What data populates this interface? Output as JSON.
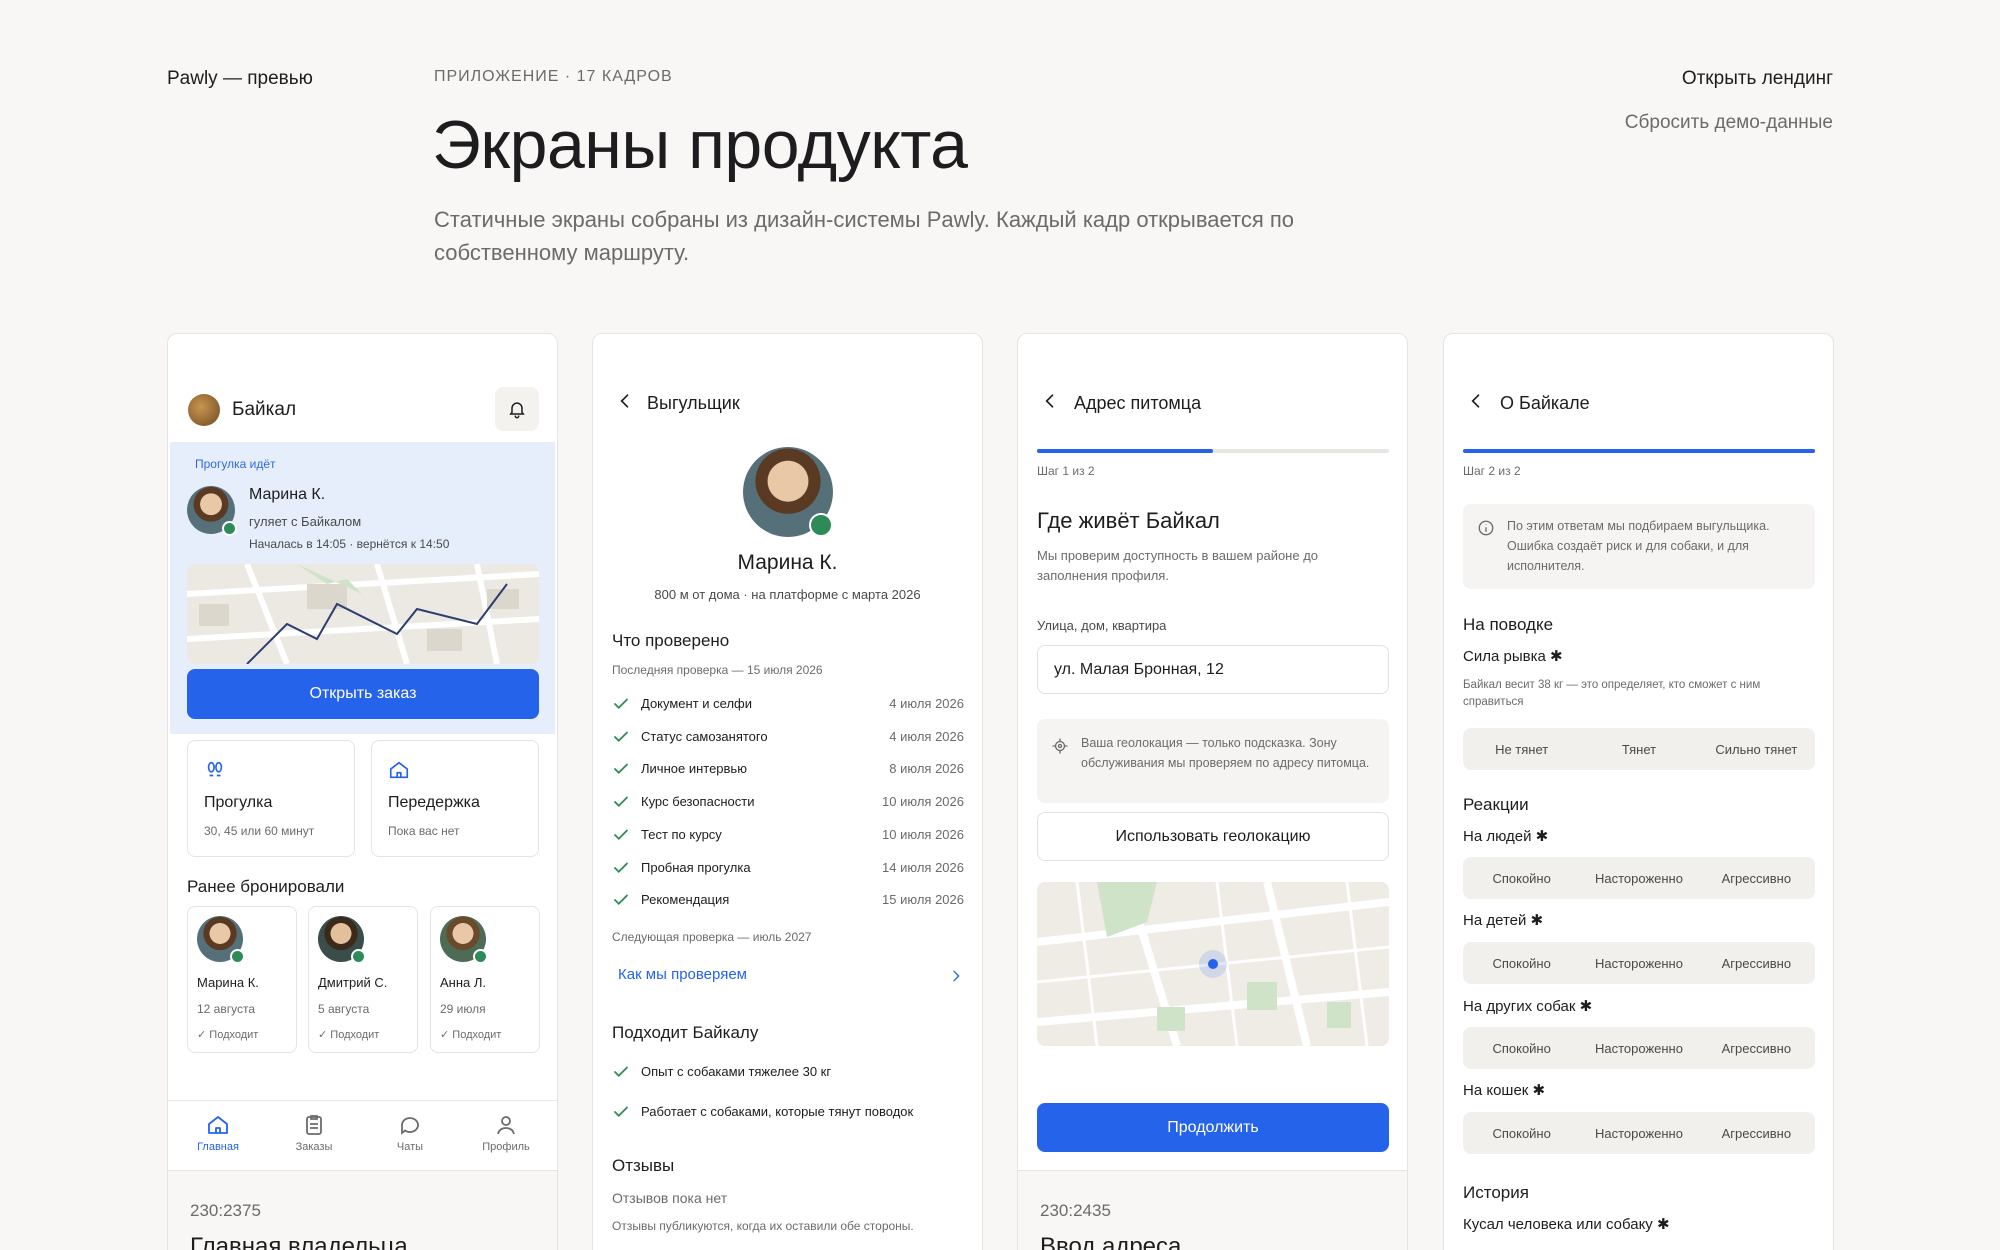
{
  "header": {
    "brand": "Pawly — превью",
    "eyebrow": "ПРИЛОЖЕНИЕ · 17 КАДРОВ",
    "title": "Экраны продукта",
    "description": "Статичные экраны собраны из дизайн-системы Pawly. Каждый кадр открывается по собственному маршруту.",
    "open_landing": "Открыть лендинг",
    "reset_demo": "Сбросить демо-данные"
  },
  "frame1": {
    "pet_name": "Байкал",
    "live": {
      "tag": "Прогулка идёт",
      "walker": "Марина К.",
      "subtitle": "гуляет с Байкалом",
      "time": "Началась в 14:05 · вернётся к 14:50",
      "button": "Открыть заказ"
    },
    "services": [
      {
        "title": "Прогулка",
        "sub": "30, 45 или 60 минут",
        "icon": "paw-icon"
      },
      {
        "title": "Передержка",
        "sub": "Пока вас нет",
        "icon": "home-icon"
      }
    ],
    "previous_title": "Ранее бронировали",
    "previous": [
      {
        "name": "Марина К.",
        "date": "12 августа",
        "fit": "Подходит"
      },
      {
        "name": "Дмитрий С.",
        "date": "5 августа",
        "fit": "Подходит"
      },
      {
        "name": "Анна Л.",
        "date": "29 июля",
        "fit": "Подходит"
      }
    ],
    "tabs": [
      "Главная",
      "Заказы",
      "Чаты",
      "Профиль"
    ],
    "frame_id": "230:2375",
    "frame_name": "Главная владельца"
  },
  "frame2": {
    "header": "Выгульщик",
    "name": "Марина К.",
    "meta": "800 м от дома · на платформе с марта 2026",
    "verified_title": "Что проверено",
    "verified_sub": "Последняя проверка — 15 июля 2026",
    "checks": [
      {
        "label": "Документ и селфи",
        "date": "4 июля 2026"
      },
      {
        "label": "Статус самозанятого",
        "date": "4 июля 2026"
      },
      {
        "label": "Личное интервью",
        "date": "8 июля 2026"
      },
      {
        "label": "Курс безопасности",
        "date": "10 июля 2026"
      },
      {
        "label": "Тест по курсу",
        "date": "10 июля 2026"
      },
      {
        "label": "Пробная прогулка",
        "date": "14 июля 2026"
      },
      {
        "label": "Рекомендация",
        "date": "15 июля 2026"
      }
    ],
    "next_check": "Следующая проверка — июль 2027",
    "how_link": "Как мы проверяем",
    "fits_title": "Подходит Байкалу",
    "fits": [
      "Опыт с собаками тяжелее 30 кг",
      "Работает с собаками, которые тянут поводок"
    ],
    "reviews_title": "Отзывы",
    "reviews_empty": "Отзывов пока нет",
    "reviews_note": "Отзывы публикуются, когда их оставили обе стороны."
  },
  "frame3": {
    "header": "Адрес питомца",
    "progress": 0.5,
    "step": "Шаг 1 из 2",
    "title": "Где живёт Байкал",
    "subtitle": "Мы проверим доступность в вашем районе до заполнения профиля.",
    "field_label": "Улица, дом, квартира",
    "field_value": "ул. Малая Бронная, 12",
    "hint": "Ваша геолокация — только подсказка. Зону обслуживания мы проверяем по адресу питомца.",
    "geo_button": "Использовать геолокацию",
    "continue_button": "Продолжить",
    "frame_id": "230:2435",
    "frame_name": "Ввод адреса"
  },
  "frame4": {
    "header": "О Байкале",
    "progress": 1.0,
    "step": "Шаг 2 из 2",
    "info": "По этим ответам мы подбираем выгульщика. Ошибка создаёт риск и для собаки, и для исполнителя.",
    "leash_title": "На поводке",
    "pull_title": "Сила рывка ✱",
    "pull_note": "Байкал весит 38 кг — это определяет, кто сможет с ним справиться",
    "pull_options": [
      "Не тянет",
      "Тянет",
      "Сильно тянет"
    ],
    "reactions_title": "Реакции",
    "reactions": [
      {
        "label": "На людей ✱",
        "options": [
          "Спокойно",
          "Настороженно",
          "Агрессивно"
        ]
      },
      {
        "label": "На детей ✱",
        "options": [
          "Спокойно",
          "Настороженно",
          "Агрессивно"
        ]
      },
      {
        "label": "На других собак ✱",
        "options": [
          "Спокойно",
          "Настороженно",
          "Агрессивно"
        ]
      },
      {
        "label": "На кошек ✱",
        "options": [
          "Спокойно",
          "Настороженно",
          "Агрессивно"
        ]
      }
    ],
    "history_title": "История",
    "history_q": "Кусал человека или собаку ✱"
  },
  "colors": {
    "accent": "#2563eb",
    "success": "#2e8b57",
    "live_bg": "#e6eefb"
  }
}
